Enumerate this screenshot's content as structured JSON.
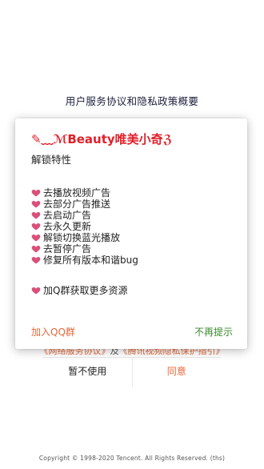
{
  "background": {
    "title": "用户服务协议和隐私政策概要",
    "link_service": "《网络服务协议》",
    "link_and": "及",
    "link_privacy": "《腾讯视频隐私保护指引》",
    "decline_label": "暂不使用",
    "agree_label": "同意",
    "copyright": "Copyright © 1998-2020 Tencent. All Rights Reserved. (ths)"
  },
  "dialog": {
    "title": "✎﹏ℳBeauty唯美小奇ℨ",
    "subtitle": "解锁特性",
    "features": [
      "去播放视频广告",
      "去部分广告推送",
      "去启动广告",
      "去永久更新",
      "解锁切换蓝光播放",
      "去暂停广告",
      "修复所有版本和谐bug"
    ],
    "extra": "加Q群获取更多资源",
    "join_label": "加入QQ群",
    "never_label": "不再提示"
  },
  "colors": {
    "title_red": "#e0202a",
    "accent_orange": "#e4683a",
    "green": "#3b8a2e",
    "heart": "#d9507a"
  }
}
